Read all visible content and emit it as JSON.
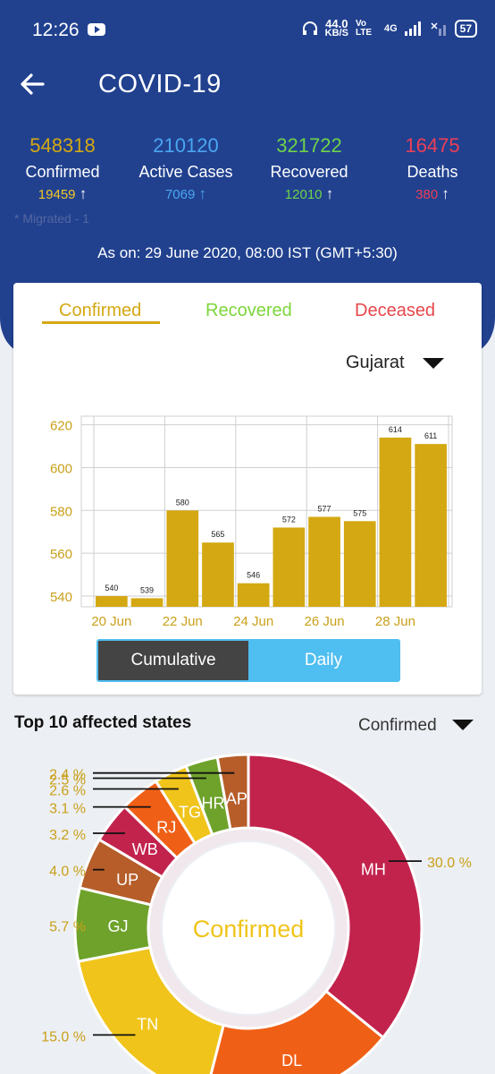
{
  "status_bar": {
    "time": "12:26",
    "net_speed": "44.0",
    "net_unit": "KB/S",
    "volte": "Vo LTE",
    "network": "4G",
    "battery": "57"
  },
  "header": {
    "title": "COVID-19"
  },
  "stats": [
    {
      "value": "548318",
      "label": "Confirmed",
      "delta": "19459",
      "color": "#d4a812"
    },
    {
      "value": "210120",
      "label": "Active Cases",
      "delta": "7069",
      "color": "#4aa6f0"
    },
    {
      "value": "321722",
      "label": "Recovered",
      "delta": "12010",
      "color": "#6ed34a"
    },
    {
      "value": "16475",
      "label": "Deaths",
      "delta": "380",
      "color": "#ec3f55"
    }
  ],
  "migrated_note": "* Migrated - 1",
  "as_on": "As on: 29 June 2020, 08:00 IST (GMT+5:30)",
  "chart_tabs": [
    {
      "label": "Confirmed",
      "color": "#d4a812"
    },
    {
      "label": "Recovered",
      "color": "#7dd63a"
    },
    {
      "label": "Deceased",
      "color": "#e6474c"
    }
  ],
  "region": "Gujarat",
  "toggle": {
    "left": "Cumulative",
    "right": "Daily"
  },
  "chart_data": {
    "type": "bar",
    "categories": [
      "20 Jun",
      "21 Jun",
      "22 Jun",
      "23 Jun",
      "24 Jun",
      "25 Jun",
      "26 Jun",
      "27 Jun",
      "28 Jun",
      "29 Jun"
    ],
    "tick_labels": [
      "20 Jun",
      "22 Jun",
      "24 Jun",
      "26 Jun",
      "28 Jun"
    ],
    "values": [
      540,
      539,
      580,
      565,
      546,
      572,
      577,
      575,
      614,
      611
    ],
    "yticks": [
      540,
      560,
      580,
      600,
      620
    ],
    "ylim": [
      535,
      624
    ],
    "bar_color": "#d4a812",
    "grid": true
  },
  "top10": {
    "title": "Top 10 affected states",
    "metric": "Confirmed",
    "center_label": "Confirmed",
    "slices": [
      {
        "state": "MH",
        "pct": 30.0,
        "label": "30.0 %",
        "color": "#c2234d"
      },
      {
        "state": "DL",
        "pct": 15.2,
        "label": "",
        "color": "#f05f16"
      },
      {
        "state": "TN",
        "pct": 15.0,
        "label": "15.0 %",
        "color": "#f0c41a"
      },
      {
        "state": "GJ",
        "pct": 5.7,
        "label": "5.7 %",
        "color": "#6ea22b"
      },
      {
        "state": "UP",
        "pct": 4.0,
        "label": "4.0 %",
        "color": "#b65d2a"
      },
      {
        "state": "WB",
        "pct": 3.2,
        "label": "3.2 %",
        "color": "#c2234d"
      },
      {
        "state": "RJ",
        "pct": 3.1,
        "label": "3.1 %",
        "color": "#f05f16"
      },
      {
        "state": "TG",
        "pct": 2.6,
        "label": "2.6 %",
        "color": "#f0c41a"
      },
      {
        "state": "HR",
        "pct": 2.5,
        "label": "2.5 %",
        "color": "#6ea22b"
      },
      {
        "state": "AP",
        "pct": 2.4,
        "label": "2.4 %",
        "color": "#b65d2a"
      }
    ]
  }
}
